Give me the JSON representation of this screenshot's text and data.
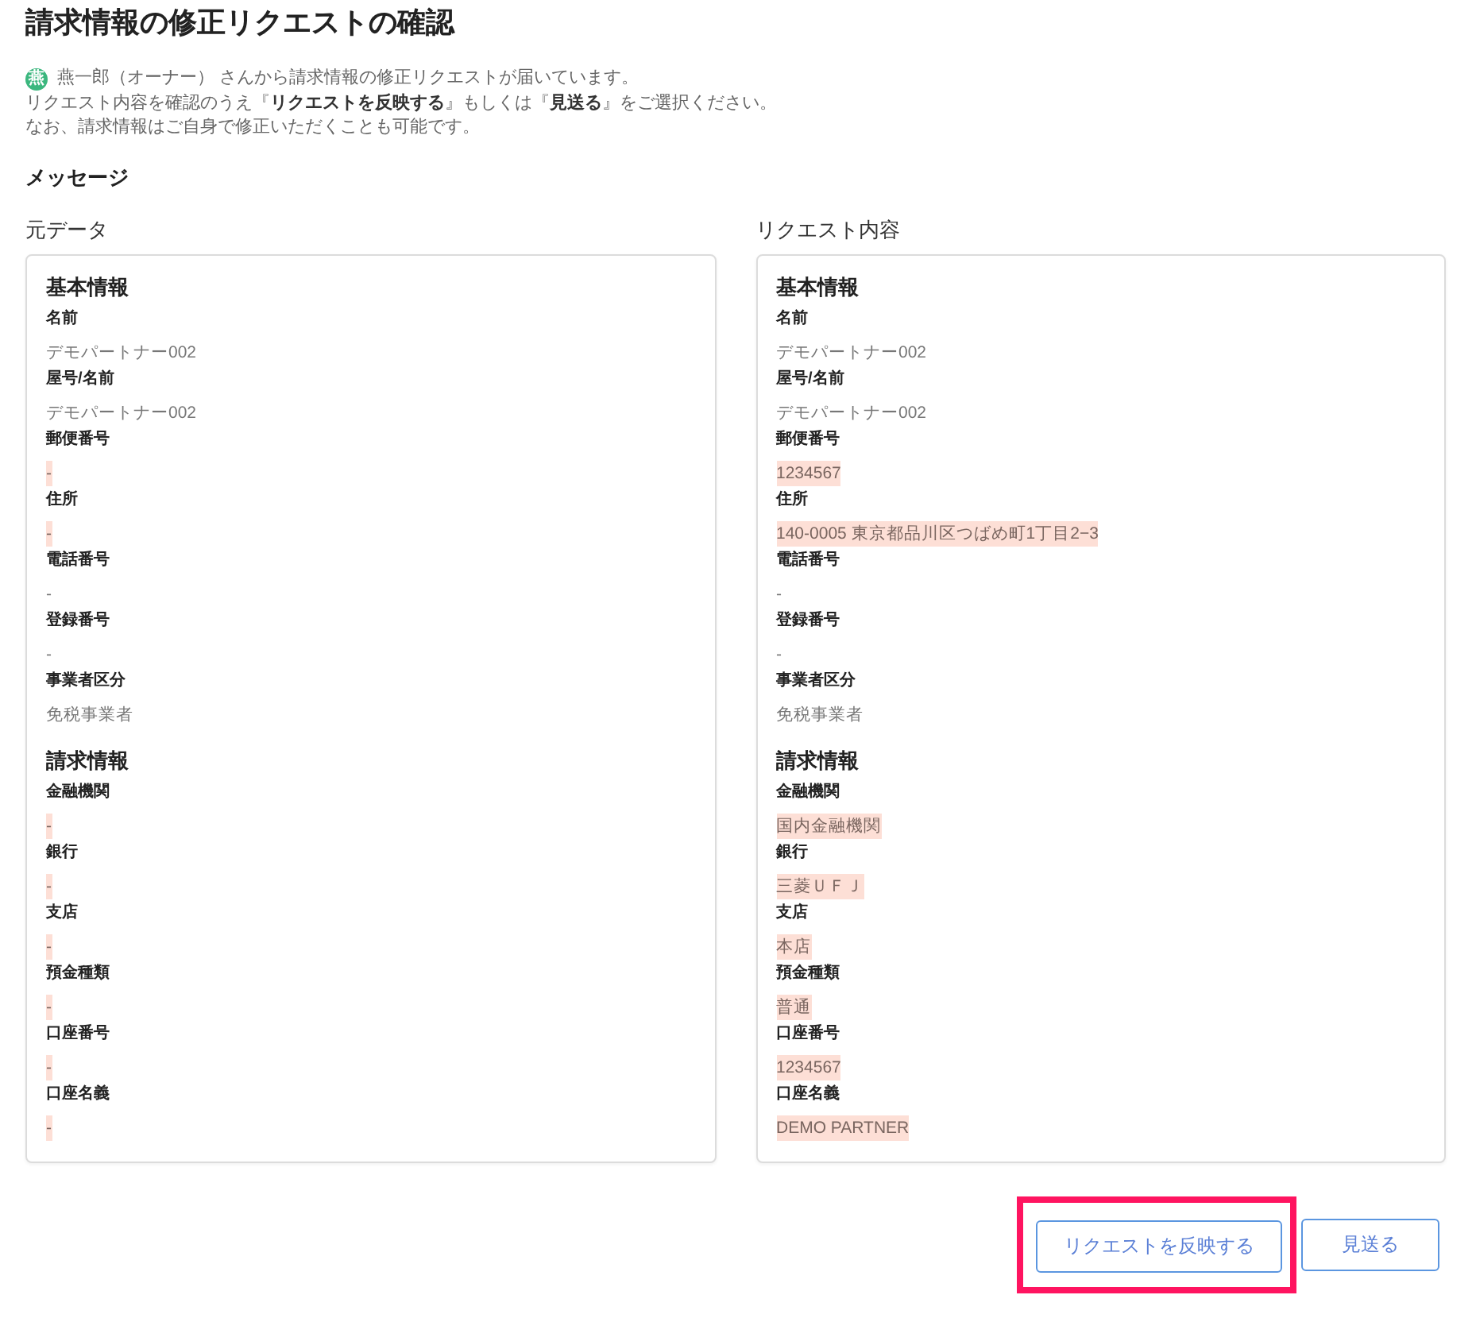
{
  "page": {
    "title": "請求情報の修正リクエストの確認"
  },
  "message": {
    "avatar": "燕",
    "lines": [
      "燕一郎（オーナー） さんから請求情報の修正リクエストが届いています。",
      "リクエスト内容を確認のうえ『**リクエストを反映する**』もしくは『**見送る**』をご選択ください。",
      "なお、請求情報はご自身で修正いただくことも可能です。"
    ]
  },
  "message_heading": "メッセージ",
  "columns": [
    {
      "heading": "元データ",
      "sections": [
        {
          "title": "基本情報",
          "fields": [
            {
              "label": "名前",
              "value": "デモパートナー002",
              "changed": false
            },
            {
              "label": "屋号/名前",
              "value": "デモパートナー002",
              "changed": false
            },
            {
              "label": "郵便番号",
              "value": "-",
              "changed": true
            },
            {
              "label": "住所",
              "value": "-",
              "changed": true
            },
            {
              "label": "電話番号",
              "value": "-",
              "changed": false
            },
            {
              "label": "登録番号",
              "value": "-",
              "changed": false
            },
            {
              "label": "事業者区分",
              "value": "免税事業者",
              "changed": false
            }
          ]
        },
        {
          "title": "請求情報",
          "fields": [
            {
              "label": "金融機関",
              "value": "-",
              "changed": true
            },
            {
              "label": "銀行",
              "value": "-",
              "changed": true
            },
            {
              "label": "支店",
              "value": "-",
              "changed": true
            },
            {
              "label": "預金種類",
              "value": "-",
              "changed": true
            },
            {
              "label": "口座番号",
              "value": "-",
              "changed": true
            },
            {
              "label": "口座名義",
              "value": "-",
              "changed": true
            }
          ]
        }
      ]
    },
    {
      "heading": "リクエスト内容",
      "sections": [
        {
          "title": "基本情報",
          "fields": [
            {
              "label": "名前",
              "value": "デモパートナー002",
              "changed": false
            },
            {
              "label": "屋号/名前",
              "value": "デモパートナー002",
              "changed": false
            },
            {
              "label": "郵便番号",
              "value": "1234567",
              "changed": true
            },
            {
              "label": "住所",
              "value": "140-0005 東京都品川区つばめ町1丁目2−3",
              "changed": true
            },
            {
              "label": "電話番号",
              "value": "-",
              "changed": false
            },
            {
              "label": "登録番号",
              "value": "-",
              "changed": false
            },
            {
              "label": "事業者区分",
              "value": "免税事業者",
              "changed": false
            }
          ]
        },
        {
          "title": "請求情報",
          "fields": [
            {
              "label": "金融機関",
              "value": "国内金融機関",
              "changed": true
            },
            {
              "label": "銀行",
              "value": "三菱ＵＦＪ",
              "changed": true
            },
            {
              "label": "支店",
              "value": "本店",
              "changed": true
            },
            {
              "label": "預金種類",
              "value": "普通",
              "changed": true
            },
            {
              "label": "口座番号",
              "value": "1234567",
              "changed": true
            },
            {
              "label": "口座名義",
              "value": "DEMO PARTNER",
              "changed": true
            }
          ]
        }
      ]
    }
  ],
  "actions": [
    {
      "label": "リクエストを反映する",
      "highlighted": true
    },
    {
      "label": "見送る",
      "highlighted": false
    }
  ]
}
